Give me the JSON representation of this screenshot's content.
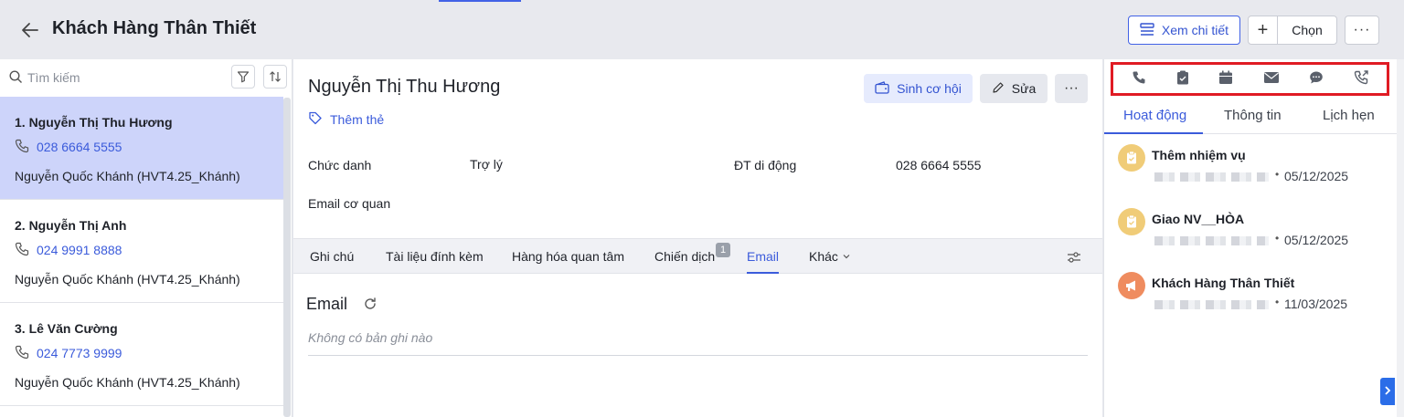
{
  "header": {
    "title": "Khách Hàng Thân Thiết",
    "view_detail_label": "Xem chi tiết",
    "add_symbol": "+",
    "select_label": "Chọn",
    "more_label": "···"
  },
  "list": {
    "search_placeholder": "Tìm kiếm",
    "items": [
      {
        "name": "1. Nguyễn Thị Thu Hương",
        "phone": "028 6664 5555",
        "owner": "Nguyễn Quốc Khánh (HVT4.25_Khánh)"
      },
      {
        "name": "2. Nguyễn Thị Anh",
        "phone": "024 9991 8888",
        "owner": "Nguyễn Quốc Khánh (HVT4.25_Khánh)"
      },
      {
        "name": "3. Lê Văn Cường",
        "phone": "024 7773 9999",
        "owner": "Nguyễn Quốc Khánh (HVT4.25_Khánh)"
      }
    ]
  },
  "detail": {
    "name": "Nguyễn Thị Thu Hương",
    "add_tag_label": "Thêm thẻ",
    "create_opportunity_label": "Sinh cơ hội",
    "edit_label": "Sửa",
    "more_label": "···",
    "fields": {
      "title_label": "Chức danh",
      "title_value": "Trợ lý",
      "mobile_label": "ĐT di động",
      "mobile_value": "028 6664 5555",
      "work_email_label": "Email cơ quan"
    },
    "tabs": [
      {
        "label": "Ghi chú"
      },
      {
        "label": "Tài liệu đính kèm"
      },
      {
        "label": "Hàng hóa quan tâm"
      },
      {
        "label": "Chiến dịch",
        "badge": "1"
      },
      {
        "label": "Email"
      },
      {
        "label": "Khác"
      }
    ],
    "section_title": "Email",
    "empty_text": "Không có bản ghi nào"
  },
  "activity": {
    "quick_actions": [
      "phone-icon",
      "task-icon",
      "calendar-icon",
      "mail-icon",
      "chat-icon",
      "outgoing-call-icon"
    ],
    "tabs": [
      "Hoạt động",
      "Thông tin",
      "Lịch hẹn"
    ],
    "items": [
      {
        "title": "Thêm nhiệm vụ",
        "date": "05/12/2025",
        "icon": "clipboard-icon",
        "color": "#f0cc78"
      },
      {
        "title": "Giao NV__HÒA",
        "date": "05/12/2025",
        "icon": "clipboard-icon",
        "color": "#f0cc78"
      },
      {
        "title": "Khách Hàng Thân Thiết",
        "date": "11/03/2025",
        "icon": "megaphone-icon",
        "color": "#ef8c5f"
      }
    ]
  },
  "colors": {
    "accent": "#3b5bdb",
    "highlight_box": "#e01b24",
    "active_row": "#cdd4fa"
  }
}
